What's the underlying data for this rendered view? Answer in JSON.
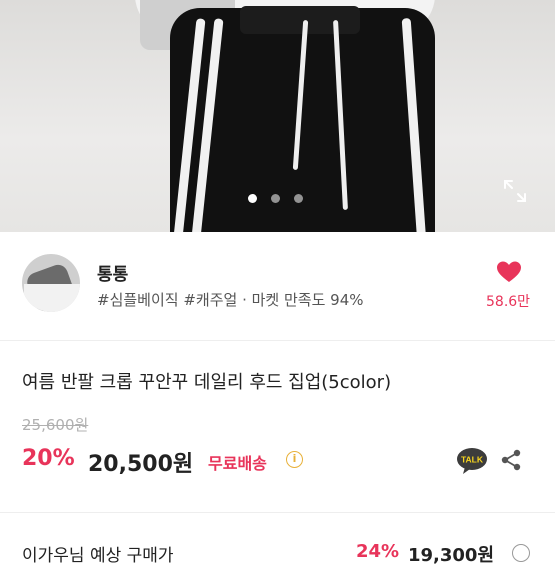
{
  "product_image": {
    "carousel_dots": [
      "1",
      "2",
      "3"
    ],
    "active_dot": 0
  },
  "seller": {
    "name": "통통",
    "tags": "#심플베이직 #캐주얼 · 마켓 만족도 94%",
    "likes": "58.6만"
  },
  "product": {
    "title": "여름 반팔 크롭 꾸안꾸 데일리 후드 집업(5color)",
    "original_price": "25,600원",
    "discount": "20%",
    "price": "20,500원",
    "free_shipping": "무료배송",
    "info_symbol": "i"
  },
  "actions": {
    "talk_label": "TALK"
  },
  "bottom": {
    "label": "이가우님 예상 구매가",
    "discount": "24%",
    "price": "19,300원"
  },
  "colors": {
    "accent": "#e8345a",
    "info": "#e8b13a",
    "talk_bg": "#3c3c3c",
    "talk_text": "#f7d51d"
  },
  "icons": {
    "expand": "expand-icon",
    "heart": "heart-icon",
    "share": "share-icon",
    "talk": "kakao-talk-icon",
    "info": "info-icon"
  }
}
